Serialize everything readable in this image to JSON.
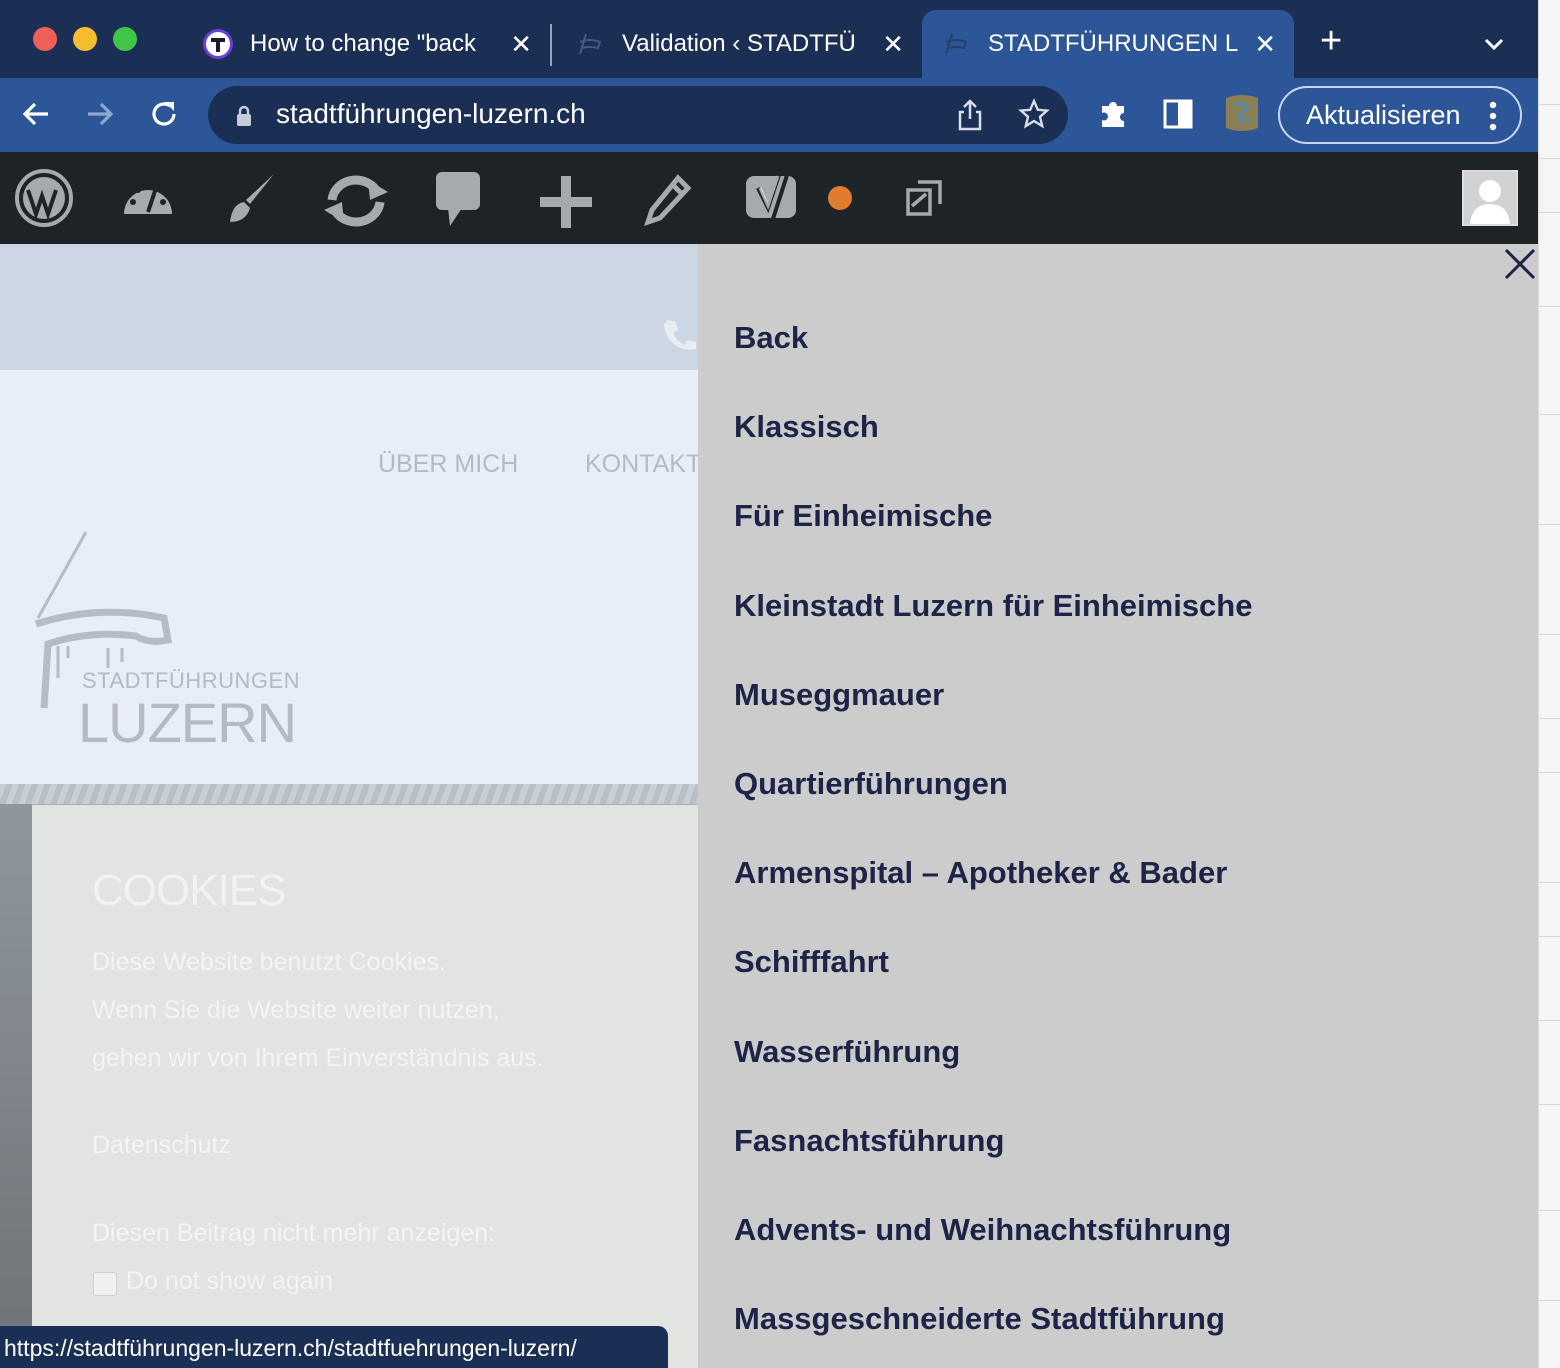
{
  "browser": {
    "tabs": [
      {
        "title": "How to change \"back",
        "favicon": "t-circle-icon"
      },
      {
        "title": "Validation ‹ STADTFÜ",
        "favicon": "site-logo-icon"
      },
      {
        "title": "STADTFÜHRUNGEN L",
        "favicon": "site-logo-icon",
        "active": true
      }
    ],
    "url": "stadtführungen-luzern.ch",
    "update_label": "Aktualisieren",
    "status_url": "https://stadtführungen-luzern.ch/stadtfuehrungen-luzern/"
  },
  "adminbar": {
    "icons": [
      "wordpress-icon",
      "dashboard-icon",
      "customize-icon",
      "updates-icon",
      "comments-icon",
      "new-icon",
      "edit-icon",
      "yoast-icon",
      "duplicate-icon"
    ],
    "notification_color": "#e07a2c"
  },
  "page": {
    "nav": {
      "ueber": "ÜBER MICH",
      "kontakt": "KONTAKT"
    },
    "logo": {
      "small": "STADTFÜHRUNGEN",
      "big": "LUZERN"
    },
    "cookie": {
      "title": "COOKIES",
      "line1": "Diese Website benutzt Cookies.",
      "line2": "Wenn Sie die Website weiter nutzen,",
      "line3": "gehen wir von Ihrem Einverständnis aus.",
      "privacy": "Datenschutz",
      "hide_label": "Diesen Beitrag nicht mehr anzeigen:",
      "checkbox_label": "Do not show again"
    }
  },
  "menu": {
    "items": [
      "Back",
      "Klassisch",
      "Für Einheimische",
      "Kleinstadt Luzern für Einheimische",
      "Museggmauer",
      "Quartierführungen",
      "Armenspital – Apotheker & Bader",
      "Schifffahrt",
      "Wasserführung",
      "Fasnachtsführung",
      "Advents- und Weihnachtsführung",
      "Massgeschneiderte Stadtführung"
    ]
  },
  "colors": {
    "tabbar": "#1b2f55",
    "toolbar": "#2c5697",
    "adminbar": "#1d2327",
    "menu_bg": "#cccccc",
    "menu_text": "#1d2447"
  }
}
